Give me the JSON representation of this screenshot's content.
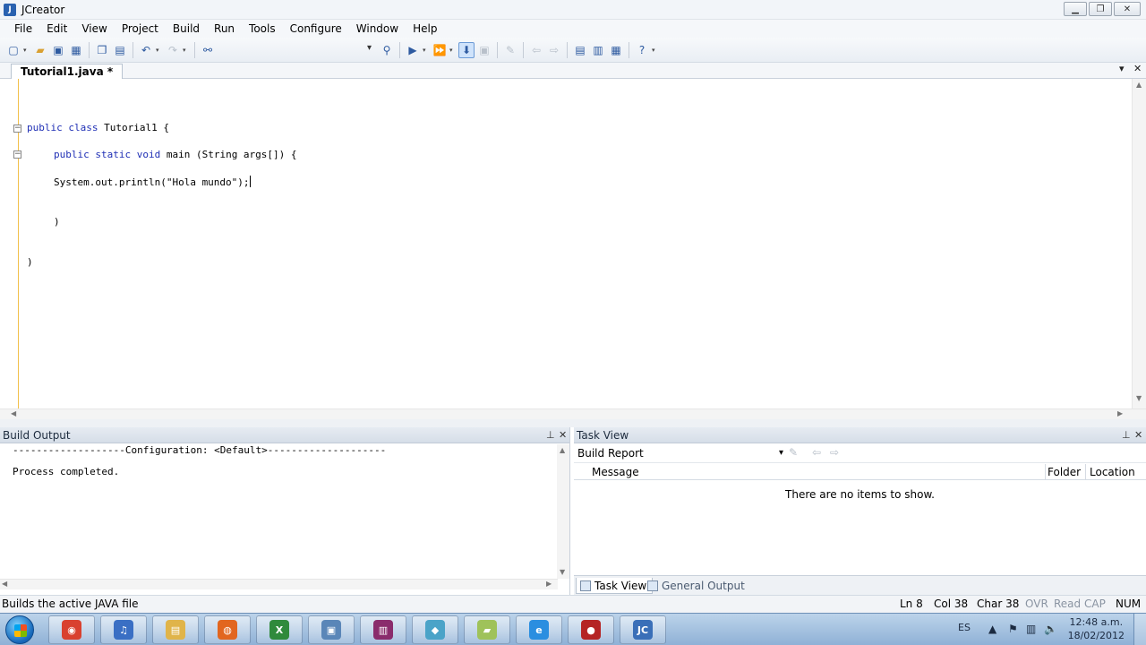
{
  "window": {
    "title": "JCreator"
  },
  "menu": [
    "File",
    "Edit",
    "View",
    "Project",
    "Build",
    "Run",
    "Tools",
    "Configure",
    "Window",
    "Help"
  ],
  "editor": {
    "tab_label": "Tutorial1.java *",
    "lines": {
      "l1_kw": "public class",
      "l1_rest": " Tutorial1 {",
      "l2_kw": "public static void",
      "l2_rest": " main (String args[]) {",
      "l3": "System.out.println(\"Hola mundo\");",
      "l4": ")",
      "l5": ")"
    }
  },
  "build_output": {
    "title": "Build Output",
    "line1": "-------------------Configuration: <Default>--------------------",
    "line2": "Process completed."
  },
  "task_view": {
    "title": "Task View",
    "filter": "Build Report",
    "columns": {
      "message": "Message",
      "folder": "Folder",
      "location": "Location"
    },
    "empty": "There are no items to show.",
    "tabs": {
      "task_view": "Task View",
      "general_output": "General Output"
    }
  },
  "status": {
    "message": "Builds the active JAVA file",
    "ln": "Ln 8",
    "col": "Col 38",
    "char": "Char 38",
    "ovr": "OVR",
    "read": "Read",
    "cap": "CAP",
    "num": "NUM"
  },
  "taskbar": {
    "lang": "ES",
    "time": "12:48 a.m.",
    "date": "18/02/2012",
    "apps": [
      {
        "name": "chrome",
        "color": "#d9412f",
        "glyph": "◉"
      },
      {
        "name": "itunes",
        "color": "#3a6fc4",
        "glyph": "♫"
      },
      {
        "name": "file-explorer",
        "color": "#e0b44a",
        "glyph": "▤"
      },
      {
        "name": "firefox",
        "color": "#e2661f",
        "glyph": "◍"
      },
      {
        "name": "excel",
        "color": "#2f8a3c",
        "glyph": "X"
      },
      {
        "name": "remote-desktop",
        "color": "#5a86b8",
        "glyph": "▣"
      },
      {
        "name": "winrar",
        "color": "#8a2c6c",
        "glyph": "▥"
      },
      {
        "name": "virtual-box",
        "color": "#4aa3c8",
        "glyph": "◆"
      },
      {
        "name": "notepad",
        "color": "#9fc25a",
        "glyph": "▰"
      },
      {
        "name": "internet-explorer",
        "color": "#2a8ee0",
        "glyph": "e"
      },
      {
        "name": "recorder",
        "color": "#b52424",
        "glyph": "●"
      },
      {
        "name": "jcreator",
        "color": "#3a6fb8",
        "glyph": "JC"
      }
    ]
  }
}
